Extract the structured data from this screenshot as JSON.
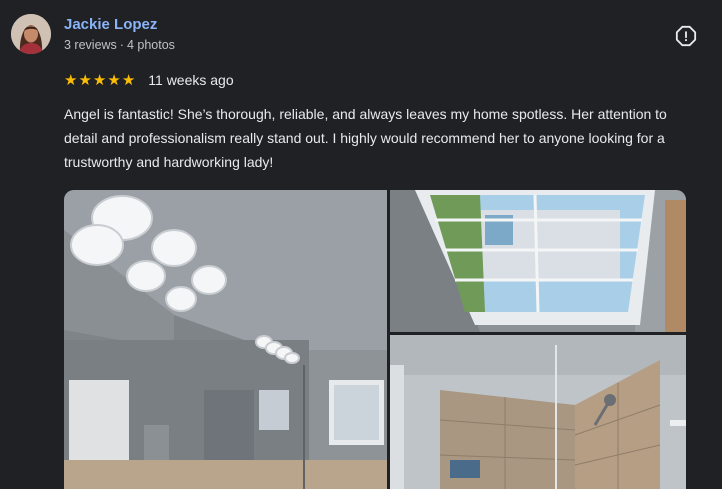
{
  "review": {
    "author": {
      "name": "Jackie Lopez",
      "reviews": "3 reviews",
      "separator": "·",
      "photos": "4 photos"
    },
    "rating": 5,
    "rating_max": 5,
    "star_icon": "★",
    "time": "11 weeks ago",
    "text": "Angel is fantastic! She’s thorough, reliable, and always leaves my home spotless. Her attention to detail and professionalism really stand out. I highly would recommend her to anyone looking for a trustworthy and hardworking lady!",
    "photos": [
      {
        "icon": "bathroom-vanity-photo"
      },
      {
        "icon": "bathroom-window-photo"
      },
      {
        "icon": "shower-photo"
      }
    ]
  },
  "colors": {
    "background": "#202124",
    "author_name": "#8ab4f8",
    "star": "#fbbc04",
    "text": "#e8eaed",
    "meta": "#bdc1c6"
  },
  "icons": {
    "more": "report-icon",
    "star": "star-icon"
  }
}
